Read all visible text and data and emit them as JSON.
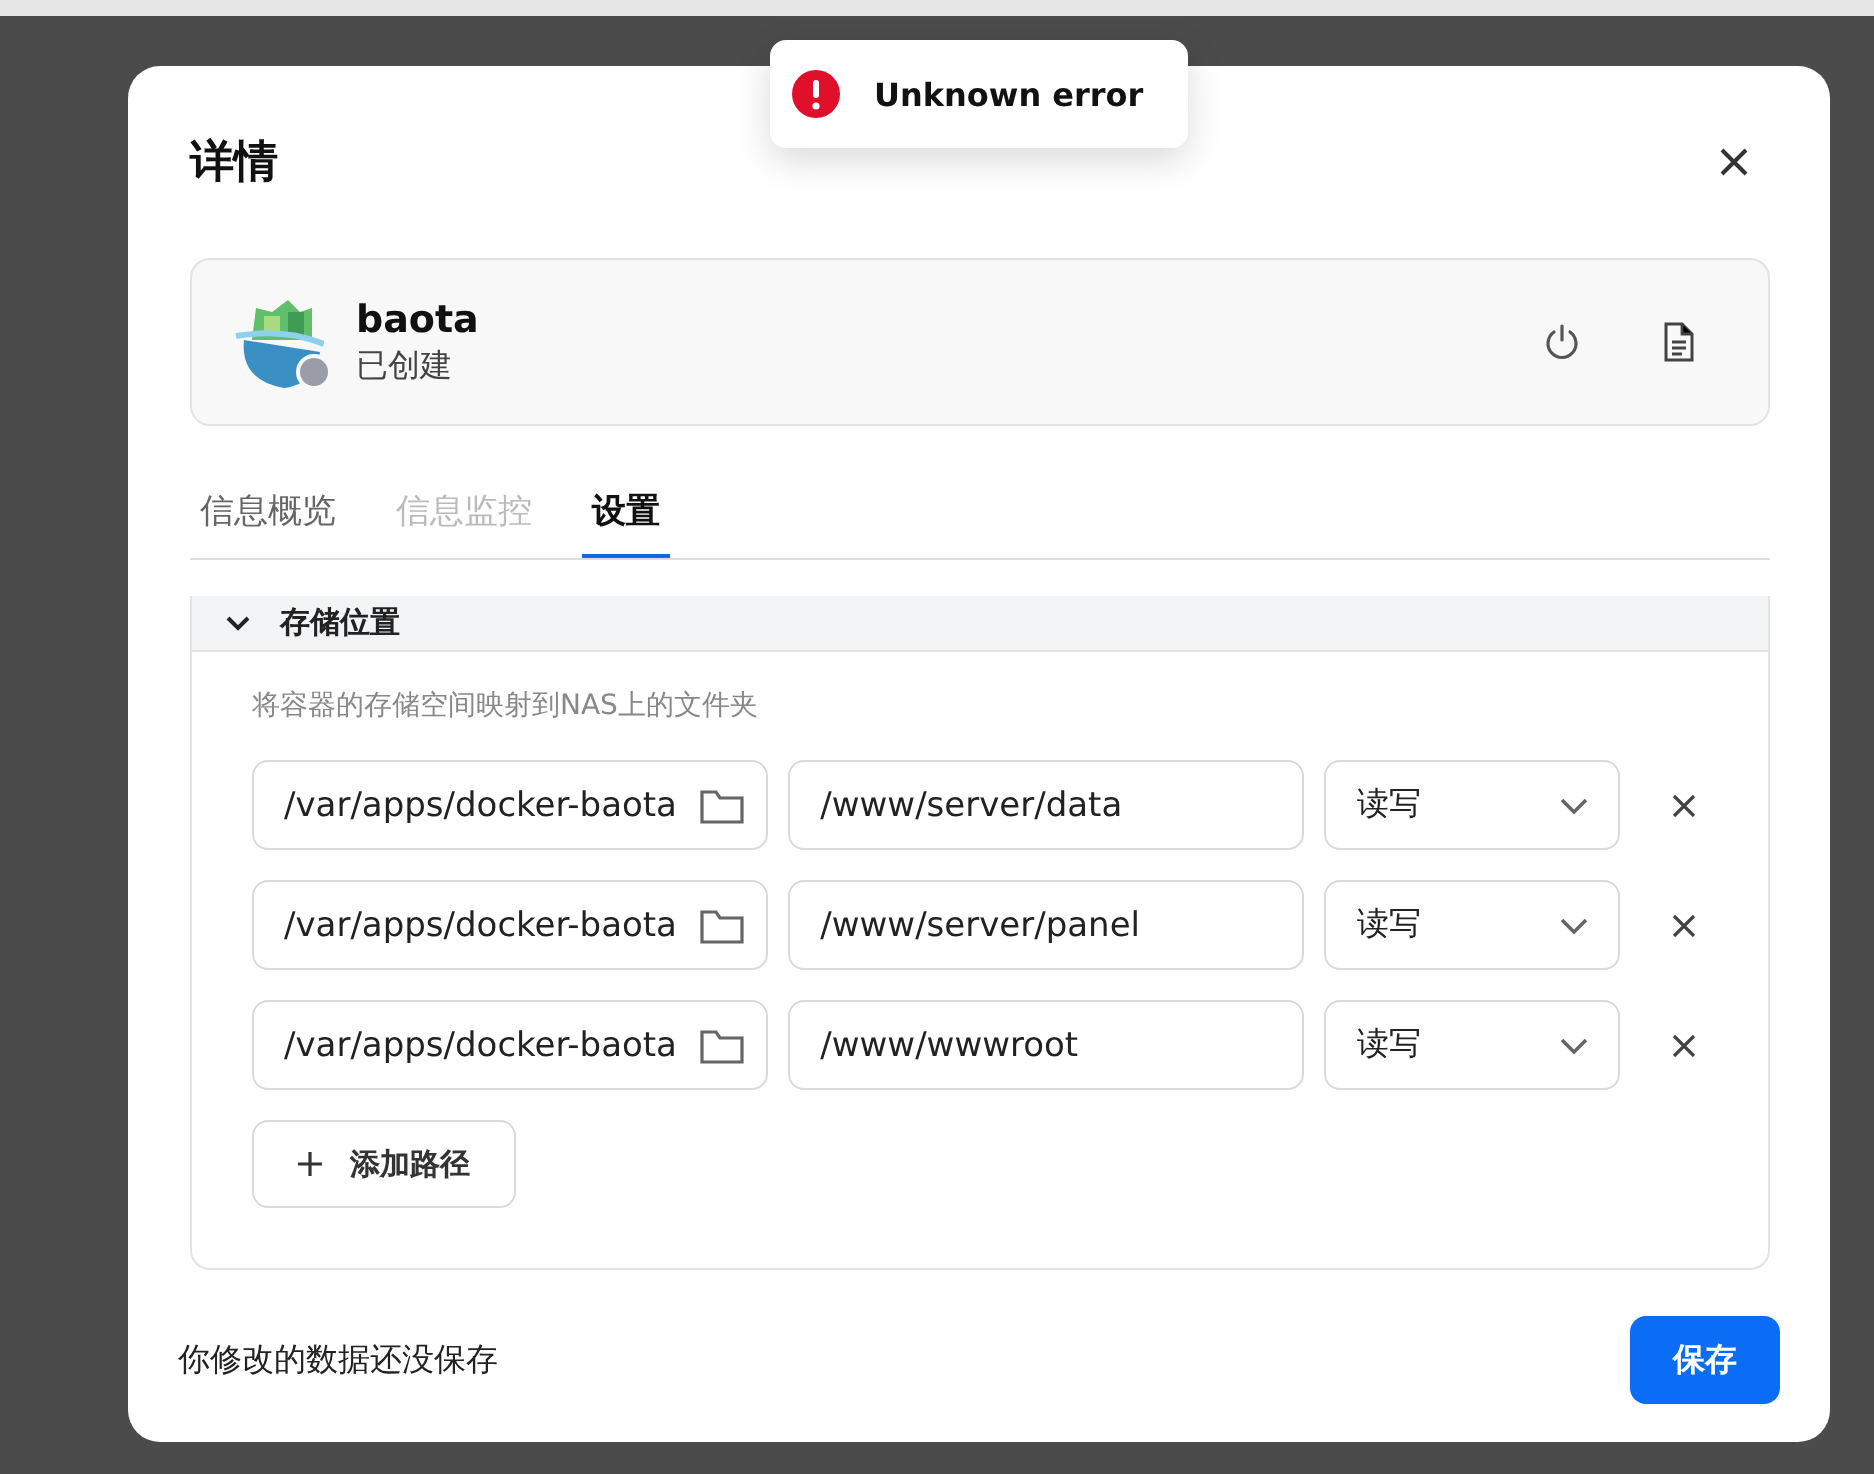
{
  "toast": {
    "message": "Unknown error"
  },
  "dialog": {
    "title": "详情",
    "container": {
      "name": "baota",
      "status": "已创建"
    },
    "tabs": [
      {
        "label": "信息概览",
        "selected": false,
        "disabled": false
      },
      {
        "label": "信息监控",
        "selected": false,
        "disabled": true
      },
      {
        "label": "设置",
        "selected": true,
        "disabled": false
      }
    ],
    "section": {
      "title": "存储位置",
      "expanded": true,
      "description": "将容器的存储空间映射到NAS上的文件夹",
      "mounts": [
        {
          "host_path": "/var/apps/docker-baota",
          "container_path": "/www/server/data",
          "mode": "读写"
        },
        {
          "host_path": "/var/apps/docker-baota",
          "container_path": "/www/server/panel",
          "mode": "读写"
        },
        {
          "host_path": "/var/apps/docker-baota",
          "container_path": "/www/wwwroot",
          "mode": "读写"
        }
      ],
      "add_button": "添加路径"
    },
    "footer": {
      "notice": "你修改的数据还没保存",
      "save_button": "保存"
    }
  }
}
